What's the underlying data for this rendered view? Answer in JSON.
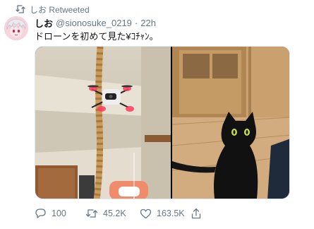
{
  "retweet_context": {
    "icon": "retweet-icon",
    "label": "しお Retweeted"
  },
  "author": {
    "display_name": "しお",
    "handle": "@sionosuke_0219",
    "separator": "·",
    "timestamp": "22h"
  },
  "tweet": {
    "text": "ドローンを初めて見た¥ｺﾁｬﾝ。"
  },
  "media": [
    {
      "icon": "drone-photo"
    },
    {
      "icon": "black-cat-photo"
    }
  ],
  "actions": {
    "reply": {
      "icon": "reply-icon",
      "count": "100"
    },
    "retweet": {
      "icon": "retweet-icon",
      "count": "45.2K"
    },
    "like": {
      "icon": "heart-icon",
      "count": "163.5K"
    },
    "share": {
      "icon": "share-icon"
    }
  },
  "colors": {
    "secondary_text": "#657786",
    "primary_text": "#14171a",
    "border": "#e1e8ed"
  }
}
